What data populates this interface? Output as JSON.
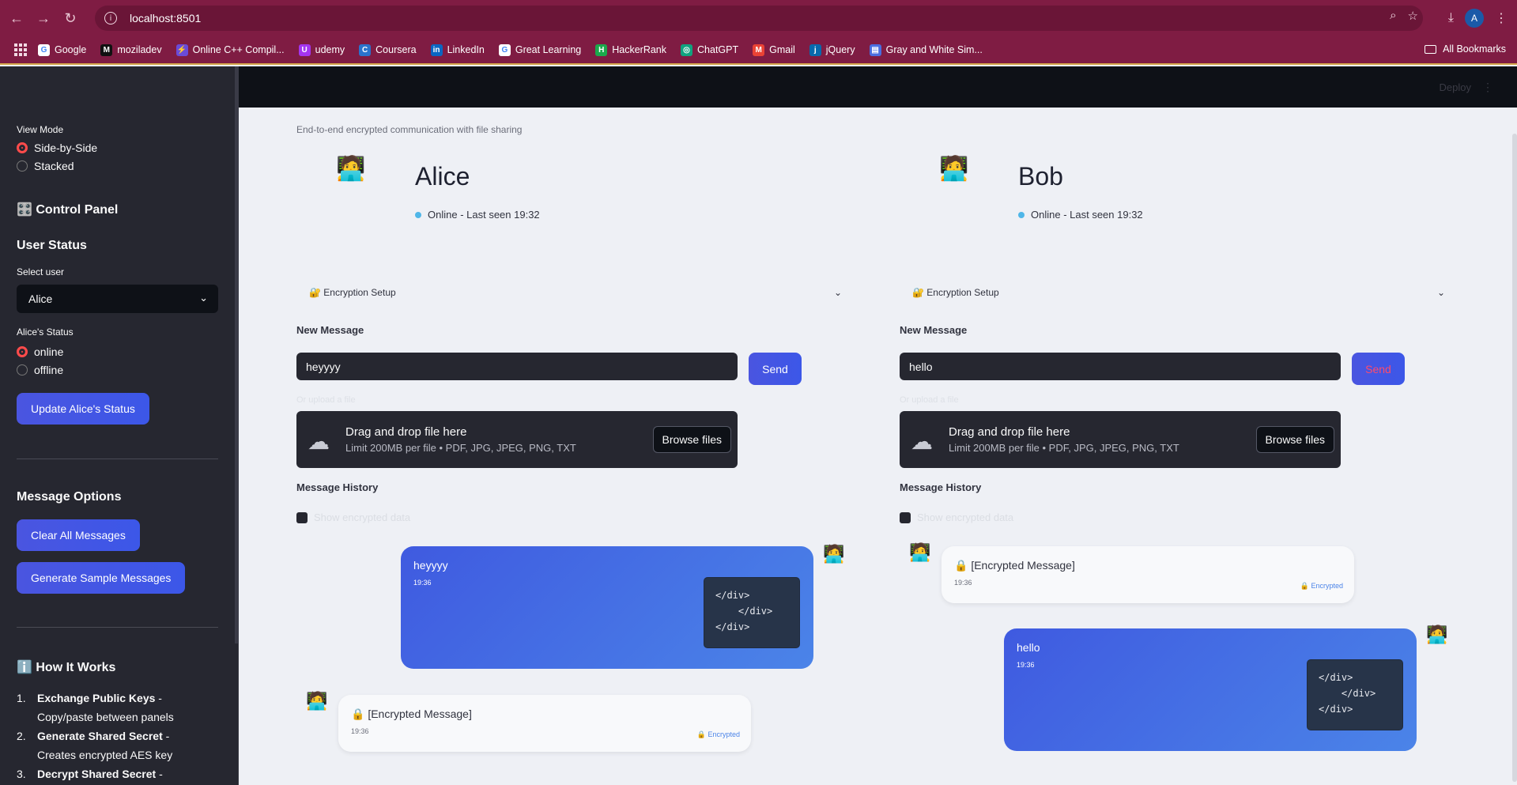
{
  "browser": {
    "url": "localhost:8501",
    "avatar_letter": "A",
    "bookmarks": [
      {
        "label": "Google",
        "color": "#ffffff",
        "glyph": "G"
      },
      {
        "label": "moziladev",
        "color": "#111111",
        "glyph": "M"
      },
      {
        "label": "Online C++ Compil...",
        "color": "#6a4bd8",
        "glyph": "⚡"
      },
      {
        "label": "udemy",
        "color": "#a435f0",
        "glyph": "U"
      },
      {
        "label": "Coursera",
        "color": "#2a73cc",
        "glyph": "C"
      },
      {
        "label": "LinkedIn",
        "color": "#0a66c2",
        "glyph": "in"
      },
      {
        "label": "Great Learning",
        "color": "#ffffff",
        "glyph": "G"
      },
      {
        "label": "HackerRank",
        "color": "#1ba94c",
        "glyph": "H"
      },
      {
        "label": "ChatGPT",
        "color": "#10a37f",
        "glyph": "◎"
      },
      {
        "label": "Gmail",
        "color": "#ea4335",
        "glyph": "M"
      },
      {
        "label": "jQuery",
        "color": "#0769ad",
        "glyph": "j"
      },
      {
        "label": "Gray and White Sim...",
        "color": "#4a6ee0",
        "glyph": "▤"
      }
    ],
    "all_bookmarks": "All Bookmarks"
  },
  "sidebar": {
    "view_mode_label": "View Mode",
    "view_modes": [
      {
        "label": "Side-by-Side",
        "selected": true
      },
      {
        "label": "Stacked",
        "selected": false
      }
    ],
    "control_panel_title": "🎛️ Control Panel",
    "user_status_title": "User Status",
    "select_user_label": "Select user",
    "selected_user": "Alice",
    "status_label": "Alice's Status",
    "status_options": [
      {
        "label": "online",
        "selected": true
      },
      {
        "label": "offline",
        "selected": false
      }
    ],
    "update_button": "Update Alice's Status",
    "message_options_title": "Message Options",
    "clear_button": "Clear All Messages",
    "sample_button": "Generate Sample Messages",
    "how_title": "ℹ️ How It Works",
    "steps": [
      {
        "num": "1.",
        "bold": "Exchange Public Keys",
        "text": " - Copy/paste between panels"
      },
      {
        "num": "2.",
        "bold": "Generate Shared Secret",
        "text": " - Creates encrypted AES key"
      },
      {
        "num": "3.",
        "bold": "Decrypt Shared Secret",
        "text": " - Establishes"
      }
    ]
  },
  "main": {
    "deploy_label": "Deploy",
    "subtitle": "End-to-end encrypted communication with file sharing",
    "panels": [
      {
        "emoji": "🧑‍💻",
        "name": "Alice",
        "status": "Online - Last seen 19:32",
        "expander": "🔐 Encryption Setup",
        "new_message_label": "New Message",
        "input_value": "heyyyy",
        "send_label": "Send",
        "upload_label": "Or upload a file",
        "drop_title": "Drag and drop file here",
        "drop_limit": "Limit 200MB per file • PDF, JPG, JPEG, PNG, TXT",
        "browse_label": "Browse files",
        "history_label": "Message History",
        "show_encrypted": "Show encrypted data",
        "messages": [
          {
            "type": "mine",
            "text": "heyyyy",
            "time": "19:36",
            "code": "</div>\n    </div>\n</div>"
          },
          {
            "type": "theirs",
            "text": "🔒 [Encrypted Message]",
            "time": "19:36",
            "badge": "🔒 Encrypted"
          }
        ]
      },
      {
        "emoji": "🧑‍💻",
        "name": "Bob",
        "status": "Online - Last seen 19:32",
        "expander": "🔐 Encryption Setup",
        "new_message_label": "New Message",
        "input_value": "hello",
        "send_label": "Send",
        "upload_label": "Or upload a file",
        "drop_title": "Drag and drop file here",
        "drop_limit": "Limit 200MB per file • PDF, JPG, JPEG, PNG, TXT",
        "browse_label": "Browse files",
        "history_label": "Message History",
        "show_encrypted": "Show encrypted data",
        "messages": [
          {
            "type": "theirs",
            "text": "🔒 [Encrypted Message]",
            "time": "19:36",
            "badge": "🔒 Encrypted"
          },
          {
            "type": "mine",
            "text": "hello",
            "time": "19:36",
            "code": "</div>\n    </div>\n</div>"
          }
        ]
      }
    ]
  }
}
